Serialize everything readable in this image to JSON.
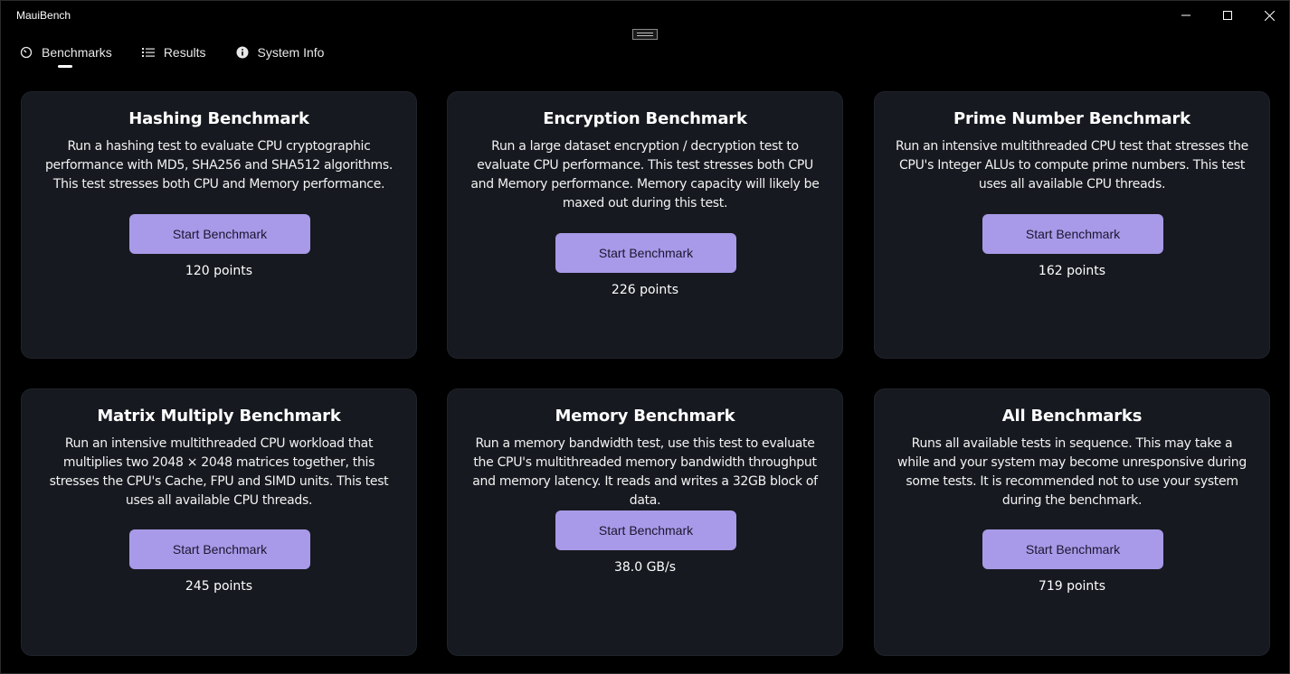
{
  "window": {
    "title": "MauiBench"
  },
  "tabs": [
    {
      "label": "Benchmarks",
      "icon": "gauge-icon",
      "active": true
    },
    {
      "label": "Results",
      "icon": "list-icon",
      "active": false
    },
    {
      "label": "System Info",
      "icon": "info-icon",
      "active": false
    }
  ],
  "cards": [
    {
      "title": "Hashing Benchmark",
      "description": "Run a hashing test to evaluate CPU cryptographic performance with MD5, SHA256 and SHA512 algorithms. This test stresses both CPU and Memory performance.",
      "button": "Start Benchmark",
      "result": "120 points"
    },
    {
      "title": "Encryption Benchmark",
      "description": "Run a large dataset encryption / decryption test to evaluate CPU performance. This test stresses both CPU and Memory performance. Memory capacity will likely be maxed out during this test.",
      "button": "Start Benchmark",
      "result": "226 points"
    },
    {
      "title": "Prime Number Benchmark",
      "description": "Run an intensive multithreaded CPU test that stresses the CPU's Integer ALUs to compute prime numbers. This test uses all available CPU threads.",
      "button": "Start Benchmark",
      "result": "162 points"
    },
    {
      "title": "Matrix Multiply Benchmark",
      "description": "Run an intensive multithreaded CPU workload that multiplies two 2048 × 2048 matrices together, this stresses the CPU's Cache, FPU and SIMD units. This test uses all available CPU threads.",
      "button": "Start Benchmark",
      "result": "245 points"
    },
    {
      "title": "Memory Benchmark",
      "description": "Run a memory bandwidth test, use this test to evaluate the CPU's multithreaded memory bandwidth throughput and memory latency. It reads and writes a 32GB block of data.",
      "button": "Start Benchmark",
      "result": "38.0 GB/s"
    },
    {
      "title": "All Benchmarks",
      "description": "Runs all available tests in sequence. This may take a while and your system may become unresponsive during some tests. It is recommended not to use your system during the benchmark.",
      "button": "Start Benchmark",
      "result": "719 points"
    }
  ],
  "colors": {
    "background": "#000000",
    "card": "#16191f",
    "accent": "#a89ae8",
    "button_text": "#1b1630"
  }
}
